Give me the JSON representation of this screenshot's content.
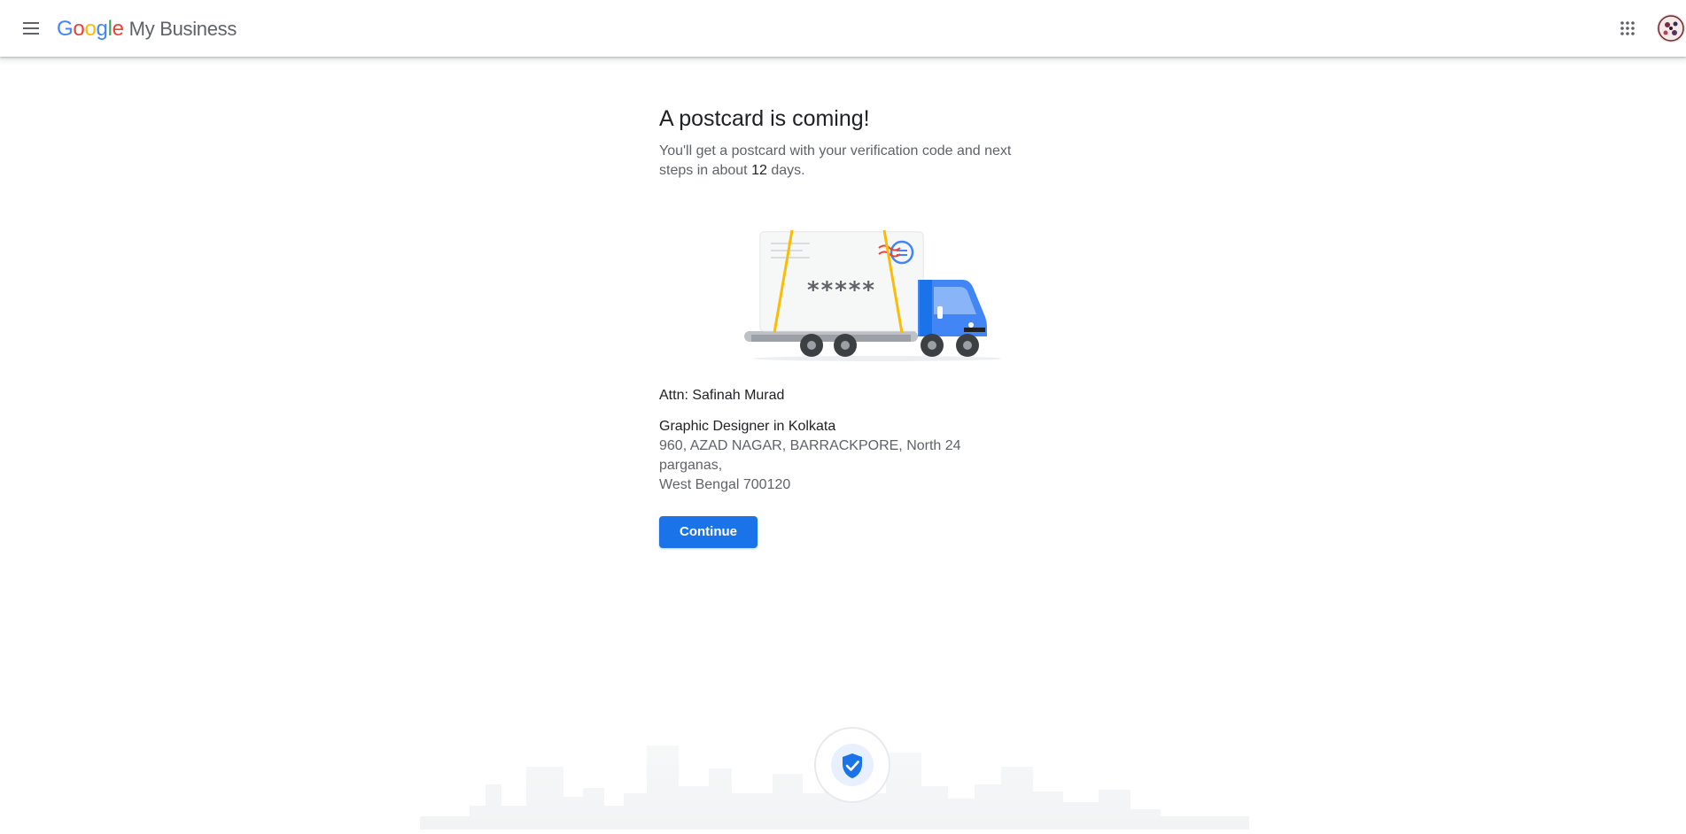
{
  "header": {
    "google_logo_letters": [
      "G",
      "o",
      "o",
      "g",
      "l",
      "e"
    ],
    "product_name": "My Business",
    "menu_icon": "hamburger-menu-icon",
    "apps_icon": "apps-grid-icon",
    "avatar": "user-avatar"
  },
  "colors": {
    "google_blue": "#4285F4",
    "google_red": "#EA4335",
    "google_yellow": "#FBBC05",
    "google_green": "#34A853",
    "button_blue": "#1a73e8",
    "truck_blue": "#4285F4"
  },
  "main": {
    "title": "A postcard is coming!",
    "subtitle_before": "You'll get a postcard with your verification code and next steps in about ",
    "subtitle_days": "12",
    "subtitle_after": " days.",
    "postcard_code_mask": "*****",
    "attn": "Attn: Safinah Murad",
    "business_name": "Graphic Designer in Kolkata",
    "address_line1": "960, AZAD NAGAR, BARRACKPORE, North 24 parganas,",
    "address_line2": "West Bengal 700120",
    "continue_label": "Continue"
  },
  "footer": {
    "badge_icon": "verified-shield-icon"
  }
}
